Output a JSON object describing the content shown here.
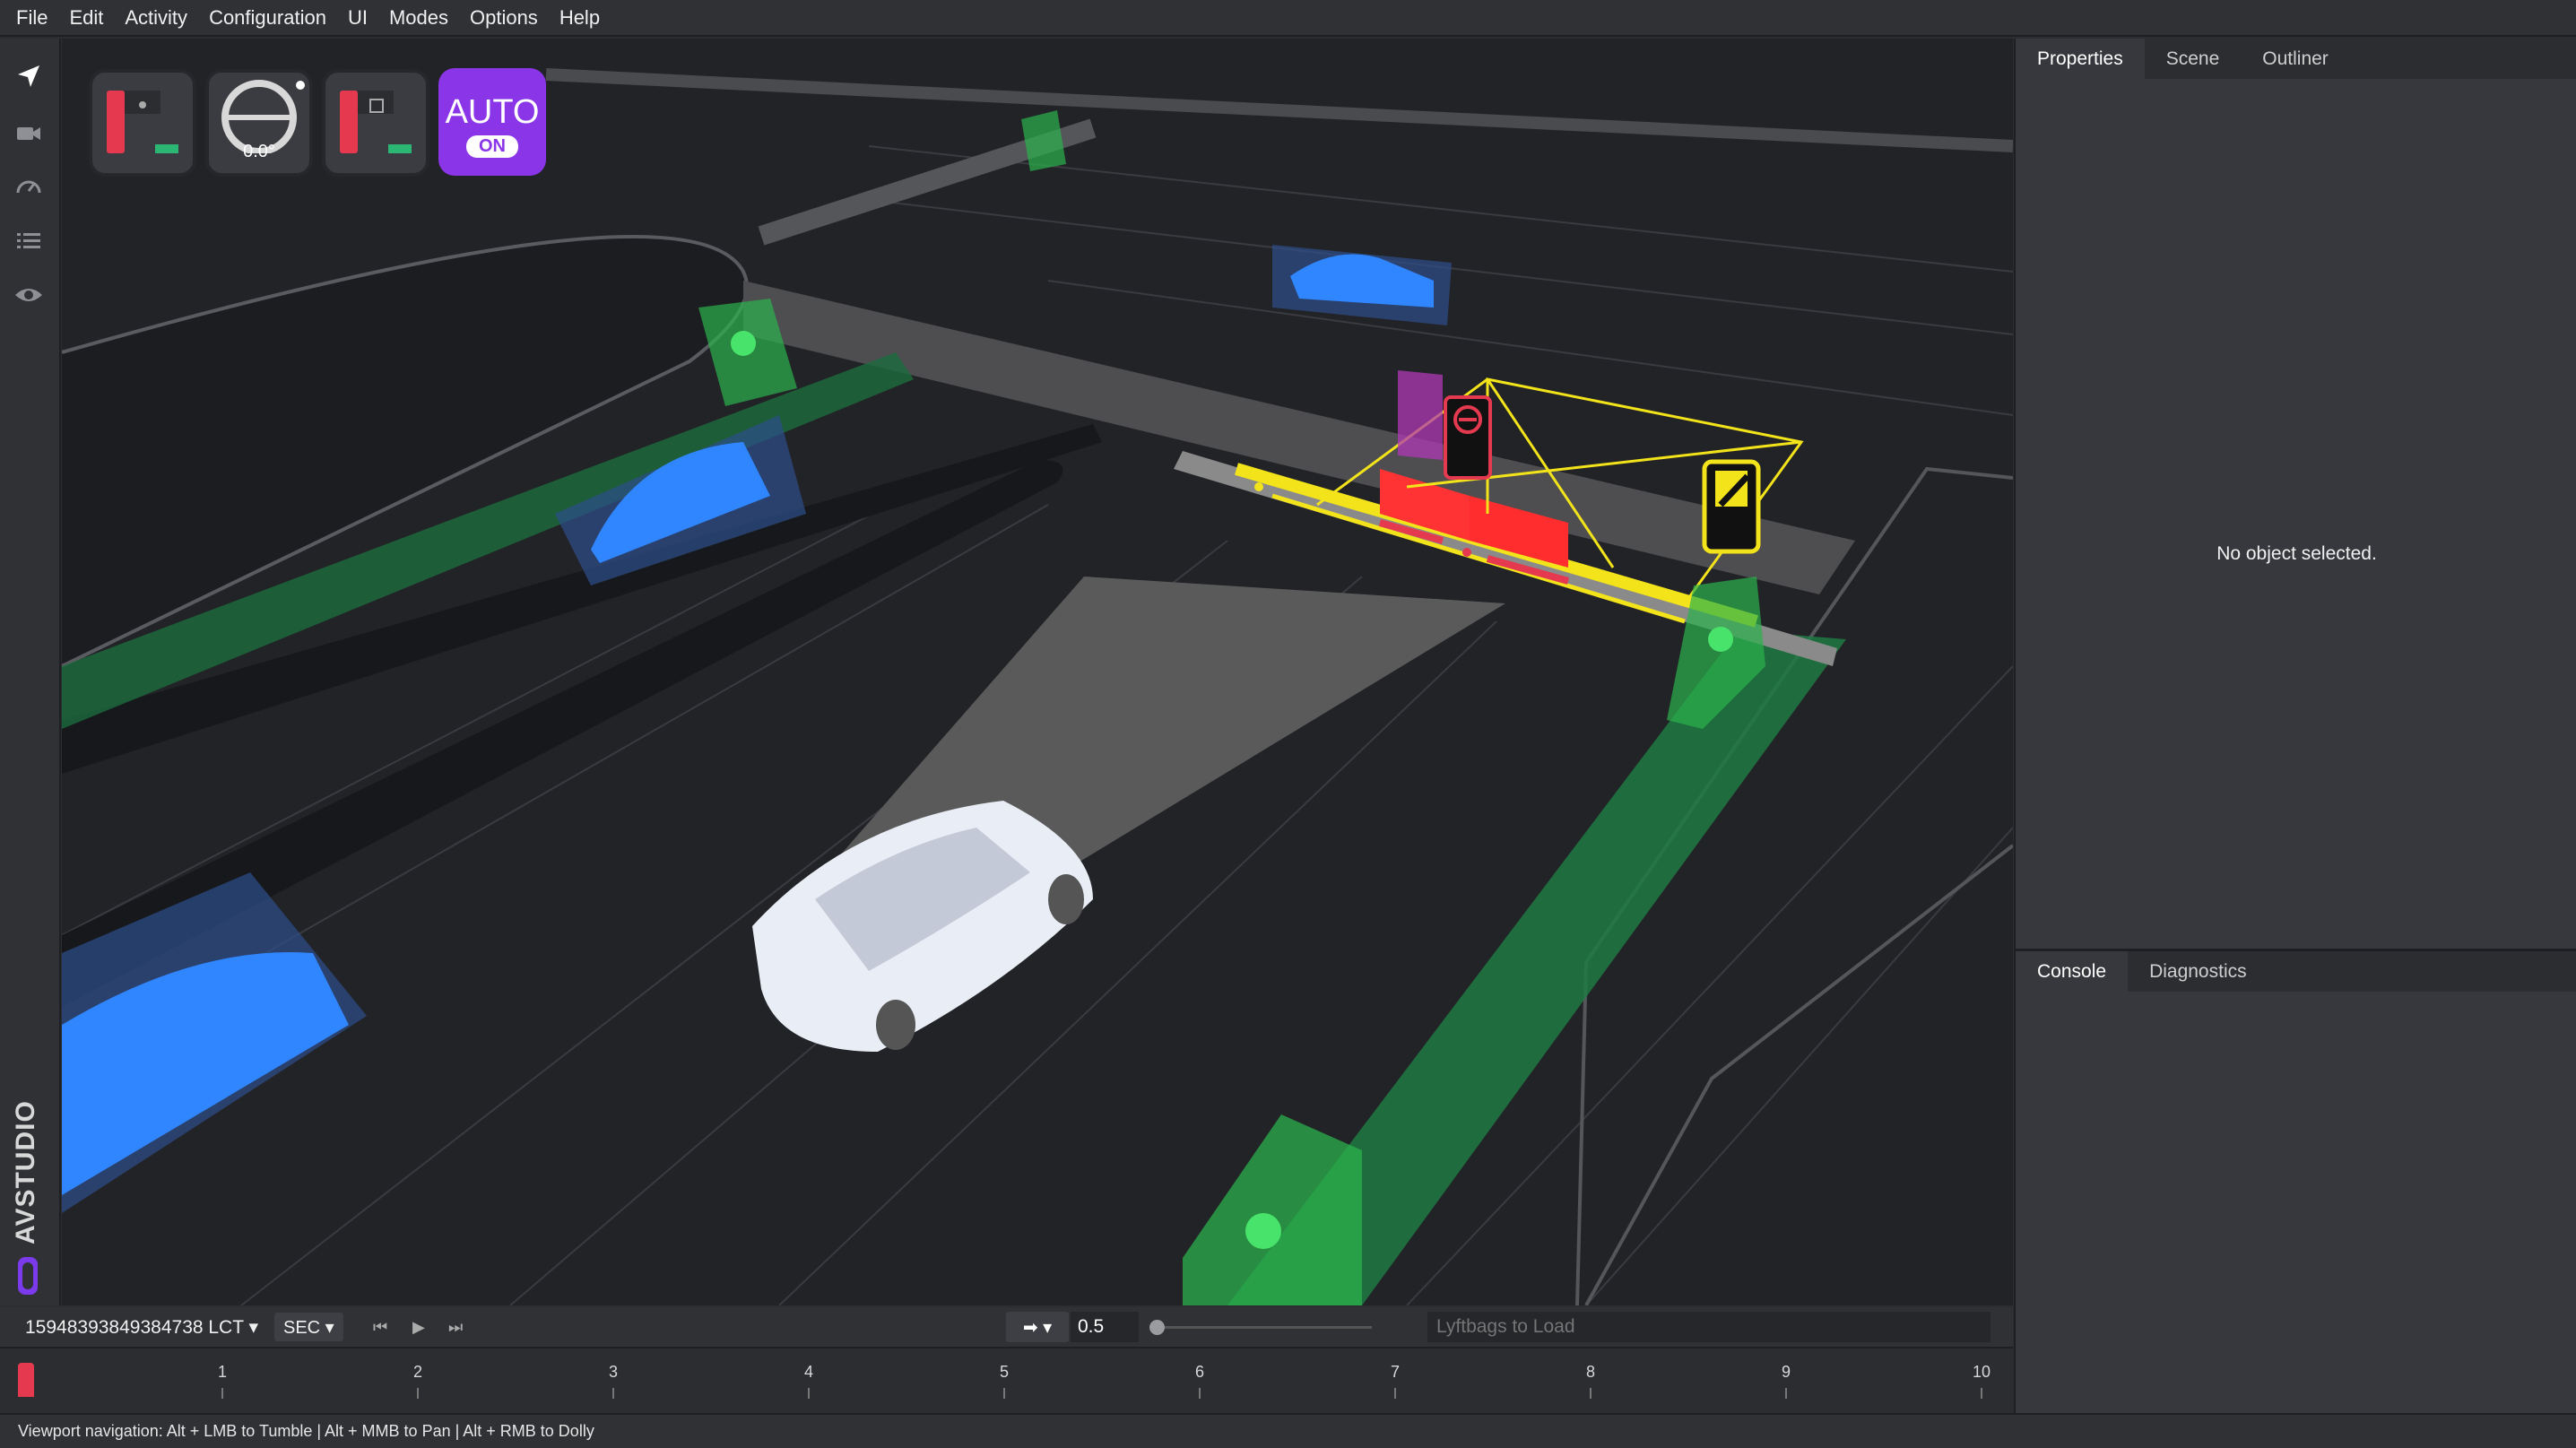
{
  "menu": [
    "File",
    "Edit",
    "Activity",
    "Configuration",
    "UI",
    "Modes",
    "Options",
    "Help"
  ],
  "toolstrip": {
    "tools": [
      {
        "name": "navigate-icon"
      },
      {
        "name": "camera-icon"
      },
      {
        "name": "speedometer-icon"
      },
      {
        "name": "list-icon"
      },
      {
        "name": "eye-icon"
      }
    ],
    "brand": "AVSTUDIO"
  },
  "hud": {
    "steering_angle": "0.0°",
    "auto_label": "AUTO",
    "auto_state": "ON",
    "colors": {
      "auto": "#8b35e8",
      "red": "#e53950",
      "green": "#2bb673"
    }
  },
  "transport": {
    "frame_id": "15948393849384738 LCT",
    "unit": "SEC",
    "speed": "0.5",
    "speed_slider_fraction": 0.0,
    "load_placeholder": "Lyftbags to Load"
  },
  "timeline": {
    "ticks": [
      "1",
      "2",
      "3",
      "4",
      "5",
      "6",
      "7",
      "8",
      "9",
      "10"
    ],
    "playhead_value": 0
  },
  "status": "Viewport navigation: Alt + LMB to Tumble | Alt + MMB to Pan | Alt + RMB to Dolly",
  "panels": {
    "top_tabs": [
      "Properties",
      "Scene",
      "Outliner"
    ],
    "top_active": "Properties",
    "empty_message": "No object selected.",
    "bottom_tabs": [
      "Console",
      "Diagnostics"
    ],
    "bottom_active": "Console"
  }
}
